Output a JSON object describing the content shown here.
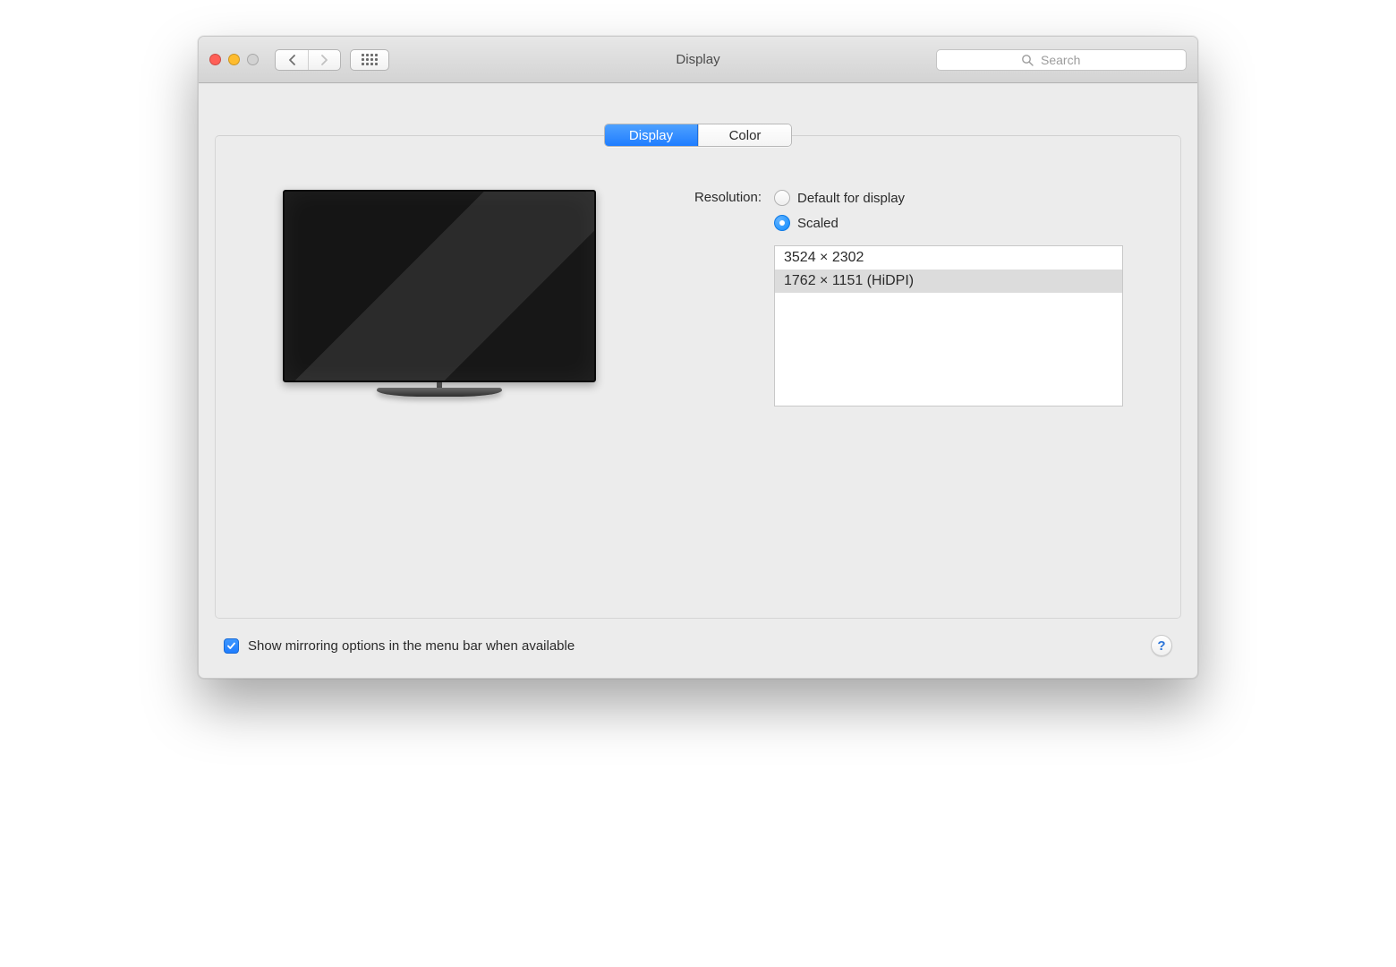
{
  "window": {
    "title": "Display"
  },
  "search": {
    "placeholder": "Search"
  },
  "tabs": {
    "display_label": "Display",
    "color_label": "Color",
    "active": "display"
  },
  "resolution": {
    "label": "Resolution:",
    "options": {
      "default_label": "Default for display",
      "scaled_label": "Scaled"
    },
    "selected_option": "scaled",
    "scaled_list": [
      {
        "text": "3524 × 2302",
        "selected": false
      },
      {
        "text": "1762 × 1151 (HiDPI)",
        "selected": true
      }
    ]
  },
  "footer": {
    "mirroring_checkbox_label": "Show mirroring options in the menu bar when available",
    "mirroring_checked": true
  },
  "help": {
    "glyph": "?"
  }
}
